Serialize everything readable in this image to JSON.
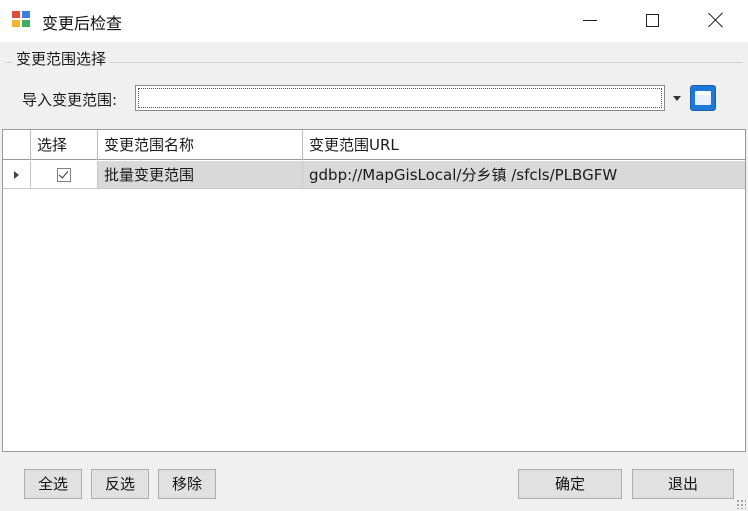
{
  "window": {
    "title": "变更后检查",
    "icon": "app-window-icon",
    "controls": {
      "minimize": "minimize-icon",
      "maximize": "maximize-icon",
      "close": "close-icon"
    }
  },
  "range_group": {
    "caption": "变更范围选择",
    "import_label": "导入变更范围:",
    "import_value": "",
    "dropdown_icon": "chevron-down-icon",
    "browse_icon": "open-file-icon"
  },
  "grid": {
    "columns": [
      "选择",
      "变更范围名称",
      "变更范围URL"
    ],
    "rows": [
      {
        "selected": true,
        "name": "批量变更范围",
        "url": "gdbp://MapGisLocal/分乡镇        /sfcls/PLBGFW"
      }
    ]
  },
  "buttons": {
    "select_all": "全选",
    "invert": "反选",
    "remove": "移除",
    "ok": "确定",
    "exit": "退出"
  },
  "colors": {
    "accent": "#1e78d7",
    "selected_row": "#d9d9d9",
    "client_bg": "#f0f0f0"
  }
}
